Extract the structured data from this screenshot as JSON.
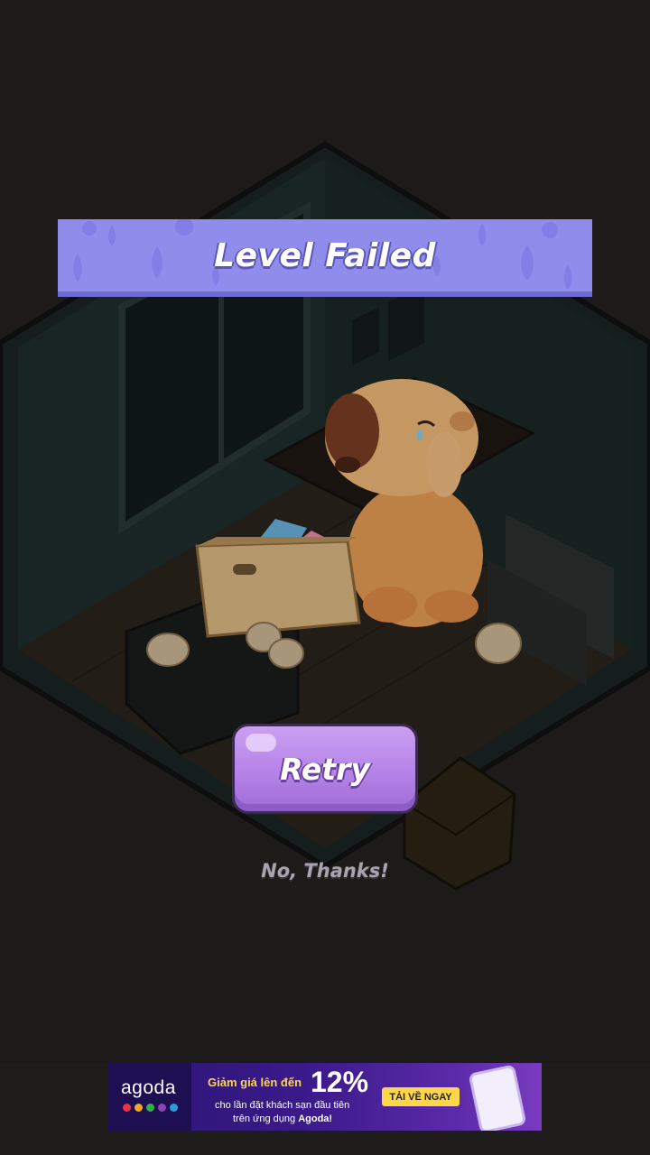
{
  "dialog": {
    "title": "Level Failed",
    "retry_label": "Retry",
    "decline_label": "No, Thanks!"
  },
  "ad": {
    "brand": "agoda",
    "line1": "Giảm giá lên đến",
    "discount": "12%",
    "line2": "cho lần đặt khách sạn đầu tiên",
    "line3_prefix": "trên ứng dụng ",
    "line3_brand": "Agoda!",
    "cta": "TẢI VỀ NGAY",
    "dot_colors": [
      "#e8334a",
      "#f5a623",
      "#34b04a",
      "#8e44ad",
      "#2d9cdb"
    ]
  },
  "colors": {
    "banner": "#8f8cec",
    "button": "#b583e8",
    "background": "#232220"
  }
}
